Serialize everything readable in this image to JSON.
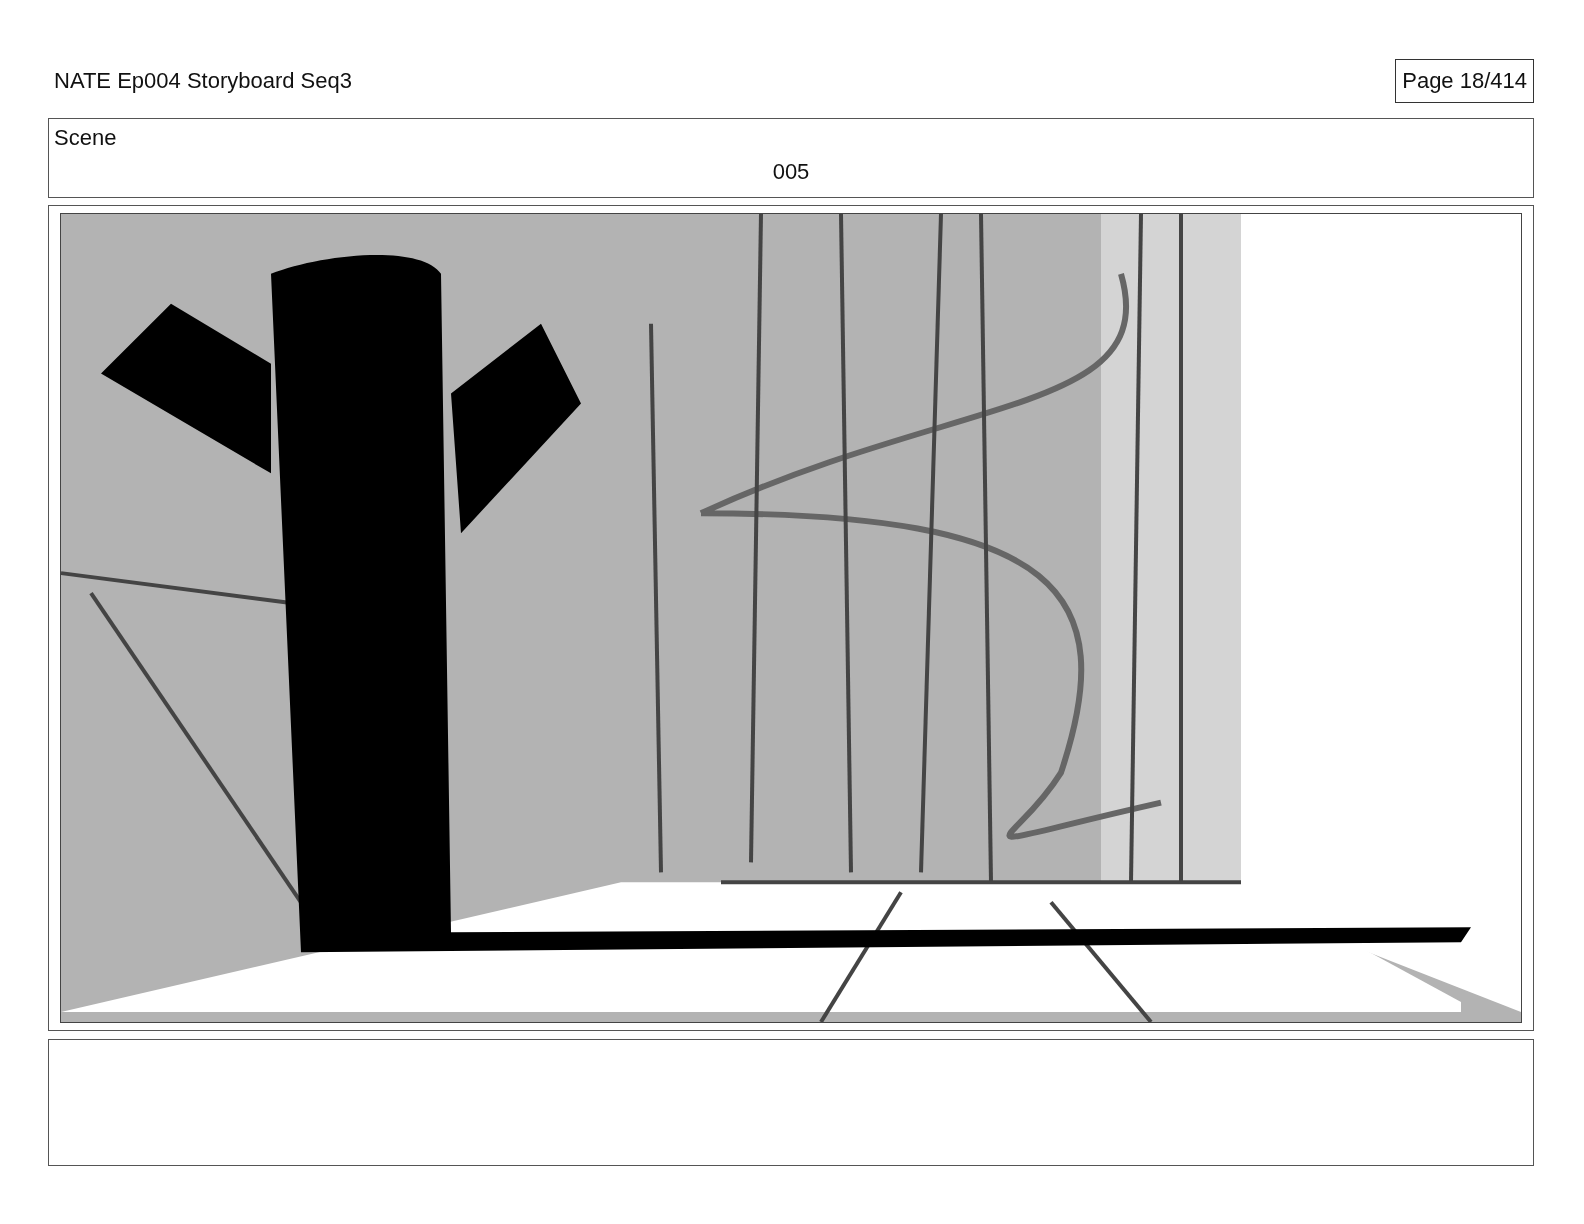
{
  "header": {
    "title": "NATE Ep004 Storyboard Seq3",
    "page": "Page 18/414"
  },
  "scene": {
    "label": "Scene",
    "number": "005"
  }
}
